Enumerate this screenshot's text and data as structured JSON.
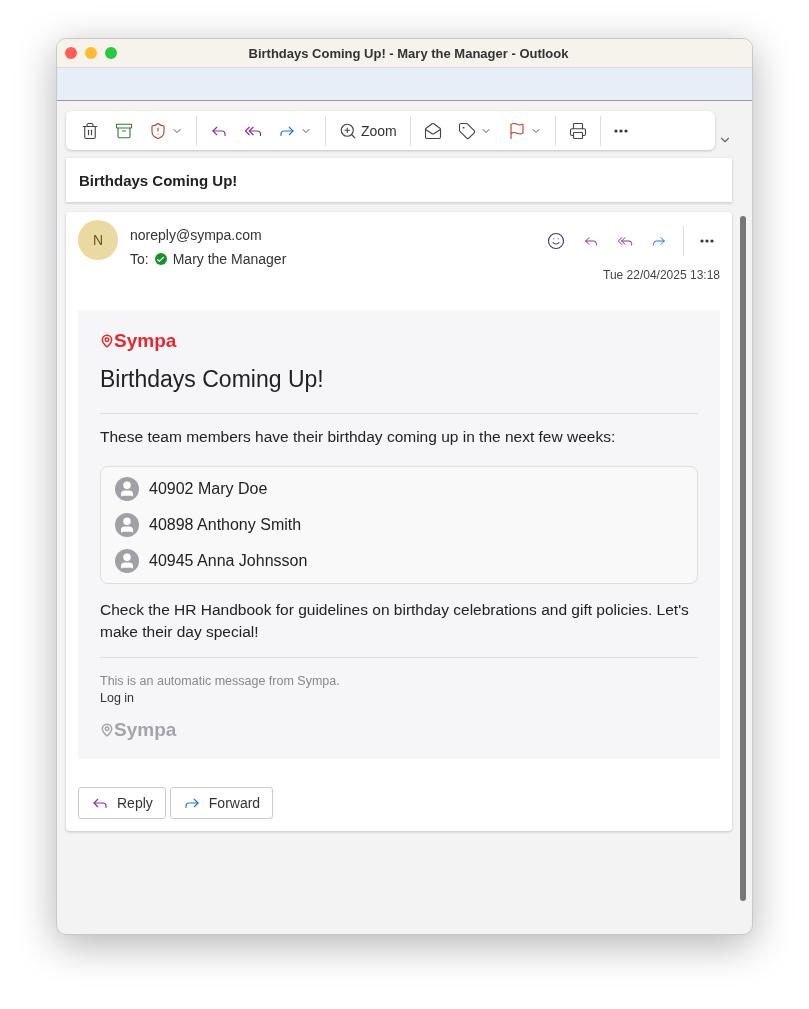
{
  "window": {
    "title": "Birthdays Coming Up! - Mary the Manager - Outlook"
  },
  "toolbar": [
    {
      "kind": "button",
      "caret": false
    },
    {
      "kind": "button",
      "caret": false
    },
    {
      "kind": "button",
      "caret": true
    },
    {
      "kind": "separator"
    },
    {
      "kind": "button",
      "caret": false
    },
    {
      "kind": "button",
      "caret": false
    },
    {
      "kind": "button",
      "caret": true
    },
    {
      "kind": "separator"
    },
    {
      "kind": "button",
      "caret": false,
      "label": "Zoom"
    },
    {
      "kind": "separator"
    },
    {
      "kind": "button",
      "caret": false
    },
    {
      "kind": "button",
      "caret": true
    },
    {
      "kind": "button",
      "caret": true
    },
    {
      "kind": "separator"
    },
    {
      "kind": "button",
      "caret": false
    },
    {
      "kind": "separator"
    },
    {
      "kind": "button",
      "caret": false
    }
  ],
  "subject": "Birthdays Coming Up!",
  "message": {
    "avatar": "N",
    "from": "noreply@sympa.com",
    "to_label": "To:",
    "to": "Mary the Manager",
    "date": "Tue 22/04/2025 13:18"
  },
  "body": {
    "logo": "Sympa",
    "heading": "Birthdays Coming Up!",
    "intro": "These team members have their birthday coming up in the next few weeks:",
    "people": [
      "40902 Mary Doe",
      "40898 Anthony Smith",
      "40945 Anna Johnsson"
    ],
    "closing": "Check the HR Handbook for guidelines on birthday celebrations and gift policies. Let's make their day special!",
    "footer_note": "This is an automatic message from Sympa.",
    "footer_link": "Log in",
    "footer_logo": "Sympa"
  },
  "actions": [
    "Reply",
    "Forward"
  ]
}
